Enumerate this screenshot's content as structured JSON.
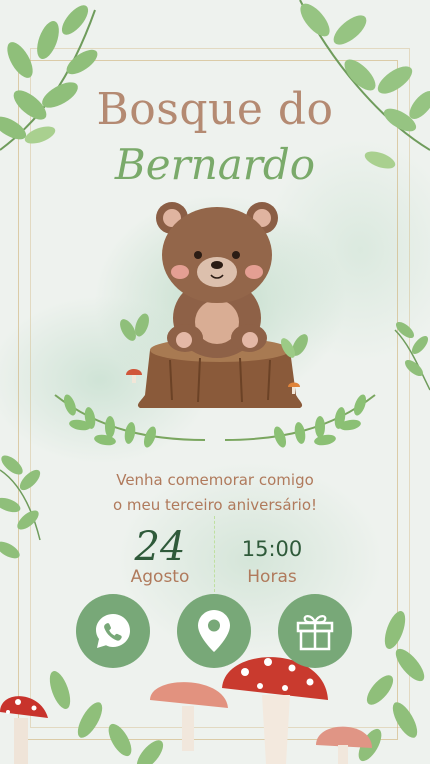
{
  "invite": {
    "title_line1": "Bosque do",
    "title_line2": "Bernardo",
    "message_line1": "Venha comemorar comigo",
    "message_line2": "o meu terceiro aniversário!",
    "day": "24",
    "month": "Agosto",
    "time": "15:00",
    "time_label": "Horas"
  },
  "actions": [
    {
      "icon": "whatsapp-icon"
    },
    {
      "icon": "location-pin-icon"
    },
    {
      "icon": "gift-icon"
    }
  ],
  "colors": {
    "title_brown": "#b48a72",
    "name_green": "#7aaa6a",
    "text_brown": "#b07a5c",
    "dark_green": "#2f5a3a",
    "button_green": "#78a878",
    "background": "#eef2ee"
  }
}
